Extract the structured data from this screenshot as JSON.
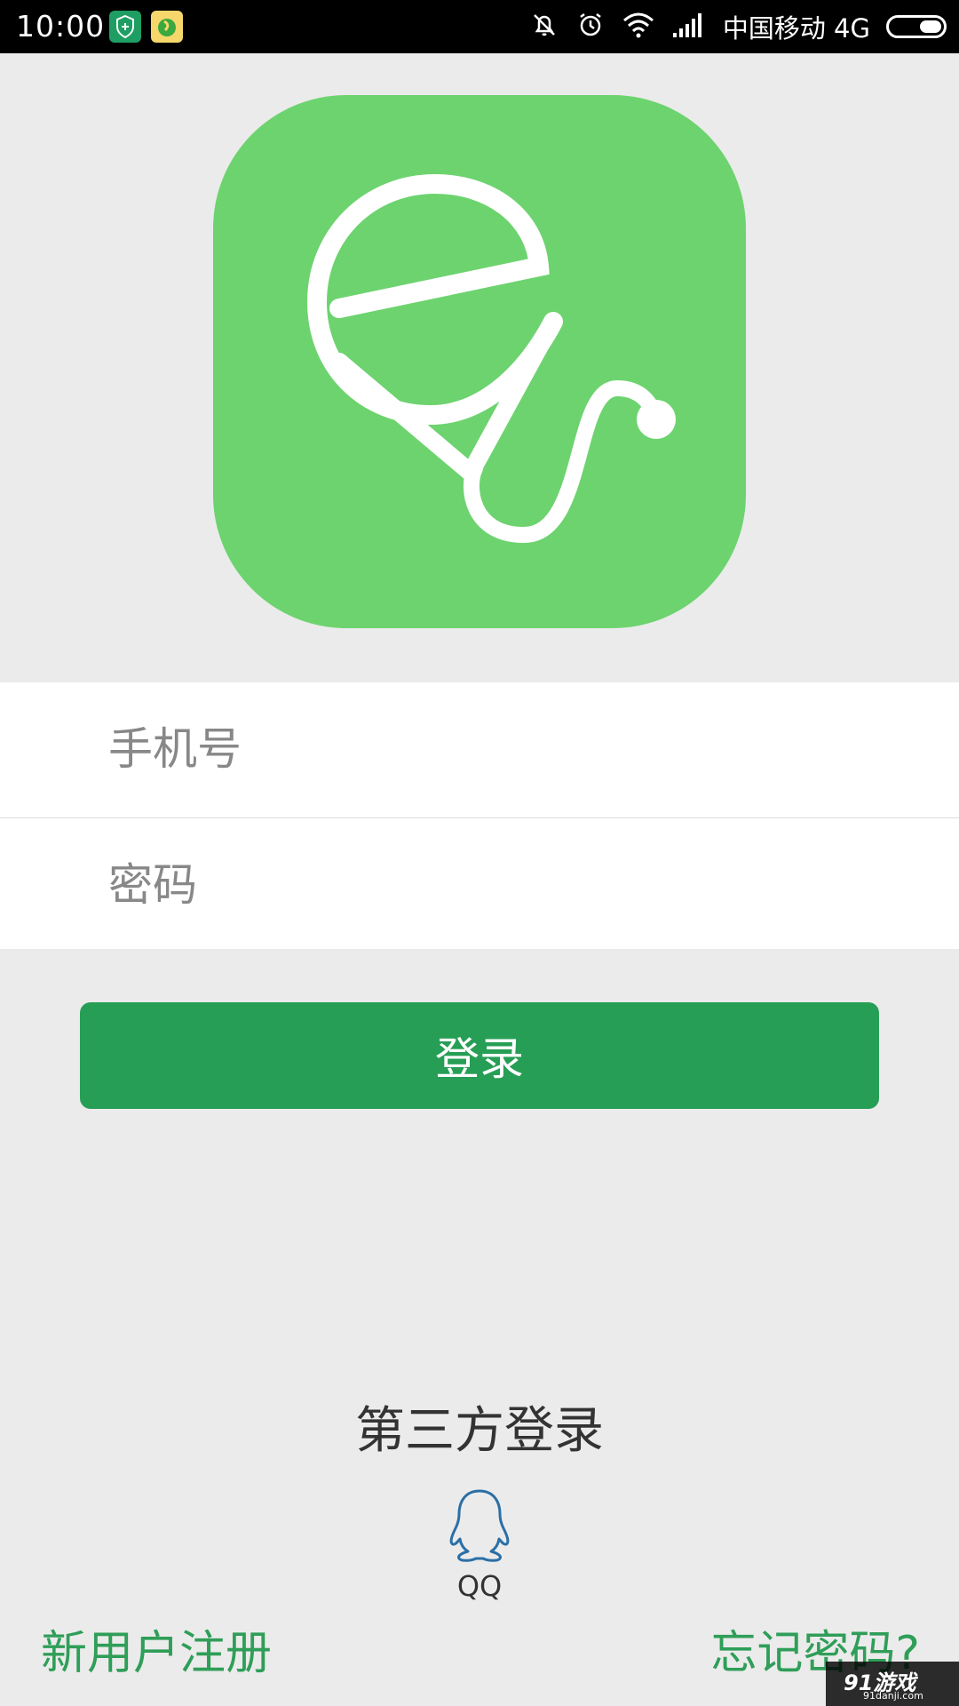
{
  "status_bar": {
    "time": "10:00",
    "carrier": "中国移动 4G",
    "icons": [
      "shield-app-icon",
      "music-app-icon",
      "silent-bell-icon",
      "alarm-icon",
      "wifi-icon",
      "signal-icon",
      "battery-icon"
    ]
  },
  "logo": {
    "icon": "stethoscope-e-logo-icon",
    "background_color": "#6dd36f"
  },
  "form": {
    "phone_placeholder": "手机号",
    "password_placeholder": "密码"
  },
  "login_button": {
    "label": "登录",
    "color": "#279e55"
  },
  "third_party": {
    "title": "第三方登录",
    "qq_label": "QQ",
    "qq_icon": "qq-penguin-icon"
  },
  "footer": {
    "register_label": "新用户注册",
    "forgot_label": "忘记密码?",
    "link_color": "#2f9e58"
  },
  "watermark": {
    "main": "91游戏",
    "sub": "91danji.com"
  }
}
